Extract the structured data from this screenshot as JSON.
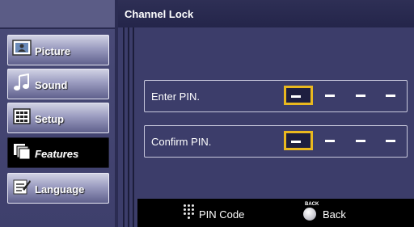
{
  "header": {
    "title": "Channel Lock"
  },
  "menu": {
    "items": [
      {
        "label": "Picture",
        "icon": "picture-icon",
        "active": false
      },
      {
        "label": "Sound",
        "icon": "sound-icon",
        "active": false
      },
      {
        "label": "Setup",
        "icon": "setup-icon",
        "active": false
      },
      {
        "label": "Features",
        "icon": "features-icon",
        "active": true
      },
      {
        "label": "Language",
        "icon": "language-icon",
        "active": false
      }
    ]
  },
  "pin": {
    "enter_label": "Enter PIN.",
    "confirm_label": "Confirm PIN.",
    "digits": 4
  },
  "footer": {
    "pin_code_label": "PIN Code",
    "back_tag": "BACK",
    "back_label": "Back"
  },
  "colors": {
    "accent": "#e9b81f",
    "background": "#3c3d6a",
    "header": "#24254a"
  }
}
